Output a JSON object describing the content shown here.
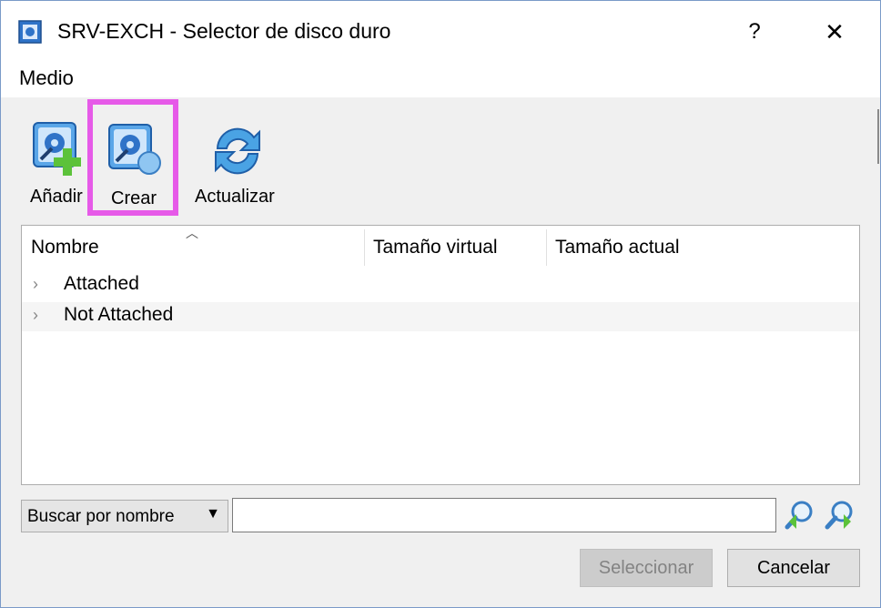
{
  "window": {
    "title": "SRV-EXCH - Selector de disco duro",
    "help_label": "?",
    "close_label": "✕"
  },
  "menu": {
    "items": [
      {
        "label": "Medio"
      }
    ]
  },
  "toolbar": {
    "add_label": "Añadir",
    "create_label": "Crear",
    "refresh_label": "Actualizar",
    "highlight_color": "#e65ae8"
  },
  "list": {
    "columns": [
      "Nombre",
      "Tamaño virtual",
      "Tamaño actual"
    ],
    "rows": [
      {
        "label": "Attached"
      },
      {
        "label": "Not Attached"
      }
    ]
  },
  "search": {
    "mode_label": "Buscar por nombre",
    "value": ""
  },
  "footer": {
    "select_label": "Seleccionar",
    "cancel_label": "Cancelar"
  }
}
